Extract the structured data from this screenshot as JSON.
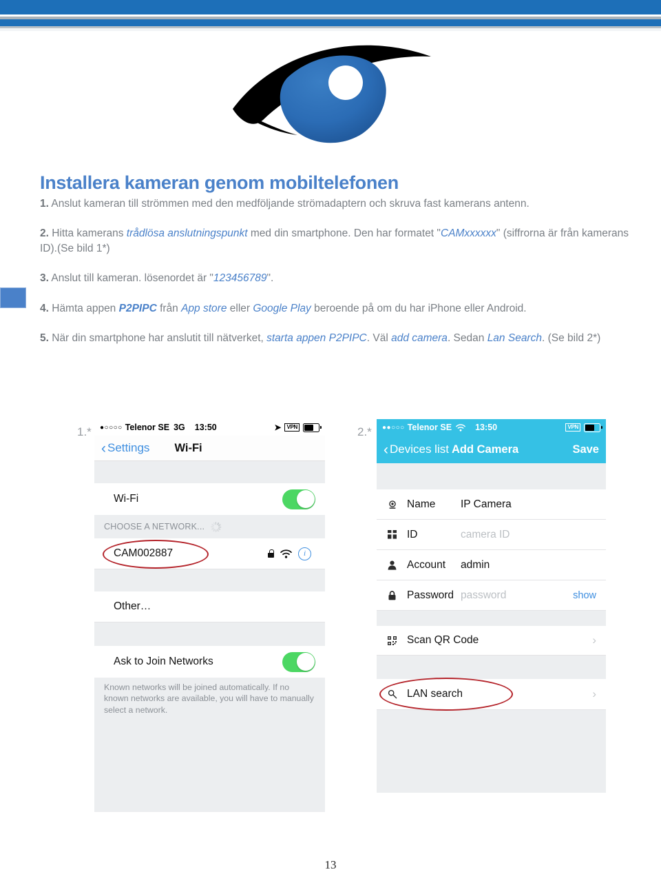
{
  "colors": {
    "header_blue": "#1d6fb8",
    "title_blue": "#4a81c9",
    "body_gray": "#7a7f85",
    "ios_blue": "#3f8fe0",
    "nav_cyan": "#35c1e5",
    "toggle_green": "#4cd763",
    "annotation_red": "#b4232a"
  },
  "logo": {
    "name": "eye-logo"
  },
  "document": {
    "title": "Installera kameran genom mobiltelefonen",
    "page_number": "13",
    "steps": [
      {
        "num": "1.",
        "parts": [
          {
            "t": " Anslut kameran till strömmen med den medföljande strömadaptern och skruva fast kamerans antenn.",
            "s": "n"
          }
        ]
      },
      {
        "num": "2.",
        "parts": [
          {
            "t": " Hitta kamerans ",
            "s": "n"
          },
          {
            "t": "trådlösa anslutningspunkt",
            "s": "i"
          },
          {
            "t": " med din smartphone. Den har formatet \"",
            "s": "n"
          },
          {
            "t": "CAMxxxxxx",
            "s": "i"
          },
          {
            "t": "\" (siffrorna är från kamerans ID).(Se bild 1*)",
            "s": "n"
          }
        ]
      },
      {
        "num": "3.",
        "parts": [
          {
            "t": " Anslut till kameran. lösenordet är \"",
            "s": "n"
          },
          {
            "t": "123456789",
            "s": "i"
          },
          {
            "t": "\".",
            "s": "n"
          }
        ]
      },
      {
        "num": "4.",
        "parts": [
          {
            "t": " Hämta appen ",
            "s": "n"
          },
          {
            "t": "P2PIPC",
            "s": "bi"
          },
          {
            "t": " från ",
            "s": "n"
          },
          {
            "t": "App store",
            "s": "i"
          },
          {
            "t": " eller ",
            "s": "n"
          },
          {
            "t": "Google Play",
            "s": "i"
          },
          {
            "t": " beroende på om du har iPhone eller Android.",
            "s": "n"
          }
        ]
      },
      {
        "num": "5.",
        "parts": [
          {
            "t": " När din smartphone har anslutit till nätverket, ",
            "s": "n"
          },
          {
            "t": "starta appen P2PIPC",
            "s": "i"
          },
          {
            "t": ". Väl ",
            "s": "n"
          },
          {
            "t": "add camera",
            "s": "i"
          },
          {
            "t": ". Sedan ",
            "s": "n"
          },
          {
            "t": "Lan Search",
            "s": "i"
          },
          {
            "t": ". (Se bild 2*)",
            "s": "n"
          }
        ]
      }
    ]
  },
  "screenshot1": {
    "label": "1.*",
    "statusbar": {
      "signal_dots": "●○○○○",
      "carrier": "Telenor SE",
      "network": "3G",
      "time": "13:50",
      "location_icon": "location-arrow-icon",
      "vpn": "VPN",
      "battery_icon": "battery-icon"
    },
    "navbar": {
      "back_label": "Settings",
      "title": "Wi-Fi"
    },
    "wifi_row": {
      "label": "Wi-Fi",
      "toggle_state": "on"
    },
    "section_header": "CHOOSE A NETWORK...",
    "network": {
      "ssid": "CAM002887",
      "lock_icon": "lock-icon",
      "wifi_icon": "wifi-icon",
      "info_icon": "info-icon",
      "highlighted": true
    },
    "other_row": "Other…",
    "ask_row": {
      "label": "Ask to Join Networks",
      "toggle_state": "on"
    },
    "footnote": "Known networks will be joined automatically. If no known networks are available, you will have to manually select a network."
  },
  "screenshot2": {
    "label": "2.*",
    "statusbar": {
      "signal_dots": "●●○○○",
      "carrier": "Telenor SE",
      "network": "wifi-icon",
      "time": "13:50",
      "vpn": "VPN",
      "battery_icon": "battery-icon"
    },
    "navbar": {
      "back_label": "Devices list",
      "title": "Add Camera",
      "action_label": "Save"
    },
    "fields": [
      {
        "icon": "camera-icon",
        "label": "Name",
        "value": "IP Camera",
        "placeholder": ""
      },
      {
        "icon": "grid-icon",
        "label": "ID",
        "value": "",
        "placeholder": "camera ID"
      },
      {
        "icon": "person-icon",
        "label": "Account",
        "value": "admin",
        "placeholder": ""
      },
      {
        "icon": "lock-icon",
        "label": "Password",
        "value": "",
        "placeholder": "password",
        "action": "show"
      }
    ],
    "actions": [
      {
        "icon": "qr-icon",
        "label": "Scan QR Code",
        "highlighted": false
      },
      {
        "icon": "search-icon",
        "label": "LAN search",
        "highlighted": true
      }
    ]
  }
}
